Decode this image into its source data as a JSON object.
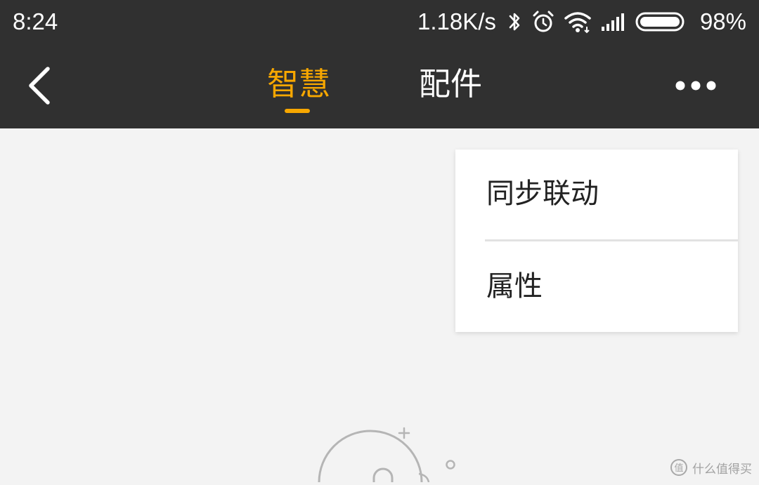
{
  "status_bar": {
    "time": "8:24",
    "net_speed": "1.18K/s",
    "battery_percent": "98%",
    "icons": [
      "bluetooth-icon",
      "alarm-icon",
      "wifi-icon",
      "signal-icon",
      "battery-icon"
    ]
  },
  "nav": {
    "tabs": [
      {
        "label": "智慧",
        "active": true
      },
      {
        "label": "配件",
        "active": false
      }
    ],
    "back_icon": "chevron-left-icon",
    "more_icon": "more-dots-icon"
  },
  "menu": {
    "items": [
      {
        "label": "同步联动"
      },
      {
        "label": "属性"
      }
    ]
  },
  "watermark": {
    "text": "什么值得买",
    "logo_text": "值"
  },
  "colors": {
    "header_bg": "#303030",
    "accent": "#f7a700",
    "page_bg": "#f3f3f3",
    "menu_bg": "#ffffff"
  }
}
